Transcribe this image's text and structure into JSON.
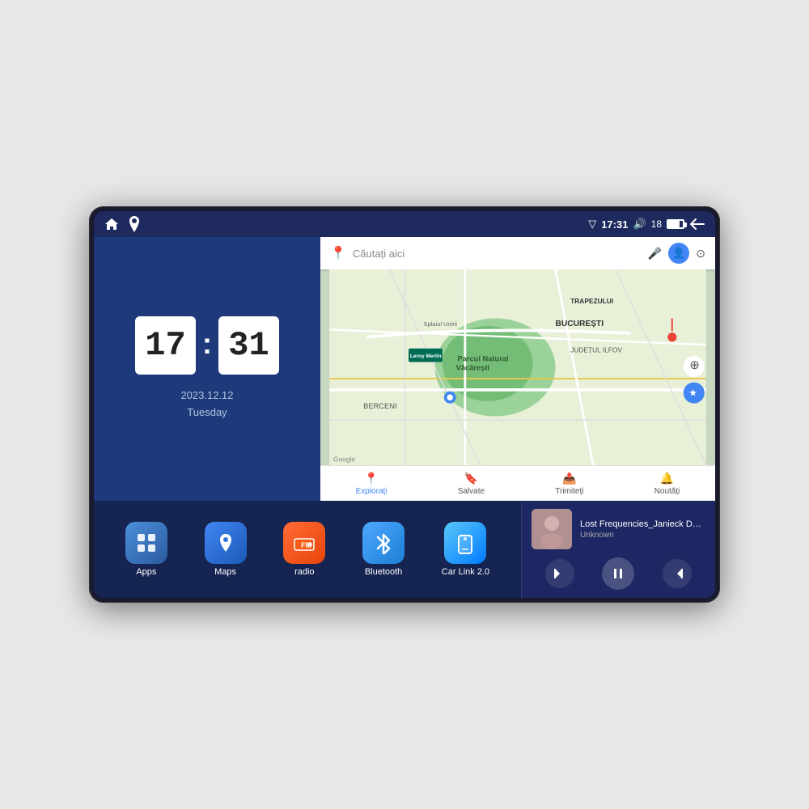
{
  "device": {
    "status_bar": {
      "time": "17:31",
      "signal_bars": "18",
      "nav_left_icon": "home",
      "nav_right_icon": "map-marker"
    },
    "clock": {
      "hour": "17",
      "minute": "31",
      "date": "2023.12.12",
      "day": "Tuesday"
    },
    "map": {
      "search_placeholder": "Căutați aici",
      "tabs": [
        {
          "label": "Explorați",
          "active": true
        },
        {
          "label": "Salvate",
          "active": false
        },
        {
          "label": "Trimiteți",
          "active": false
        },
        {
          "label": "Noutăți",
          "active": false
        }
      ],
      "locations": [
        "Parcul Natural Văcărești",
        "BUCUREȘTI",
        "JUDEȚUL ILFOV",
        "BERCENI",
        "TRAPEZULUI",
        "Leroy Merlin",
        "Google"
      ]
    },
    "apps": [
      {
        "id": "apps",
        "label": "Apps",
        "icon_class": "app-icon-apps",
        "icon": "⊞"
      },
      {
        "id": "maps",
        "label": "Maps",
        "icon_class": "app-icon-maps",
        "icon": "📍"
      },
      {
        "id": "radio",
        "label": "radio",
        "icon_class": "app-icon-radio",
        "icon": "📻"
      },
      {
        "id": "bluetooth",
        "label": "Bluetooth",
        "icon_class": "app-icon-bluetooth",
        "icon": "🔵"
      },
      {
        "id": "carlink",
        "label": "Car Link 2.0",
        "icon_class": "app-icon-carlink",
        "icon": "📱"
      }
    ],
    "media": {
      "title": "Lost Frequencies_Janieck Devy-...",
      "artist": "Unknown",
      "album_art_color": "#c0a0b0"
    }
  }
}
